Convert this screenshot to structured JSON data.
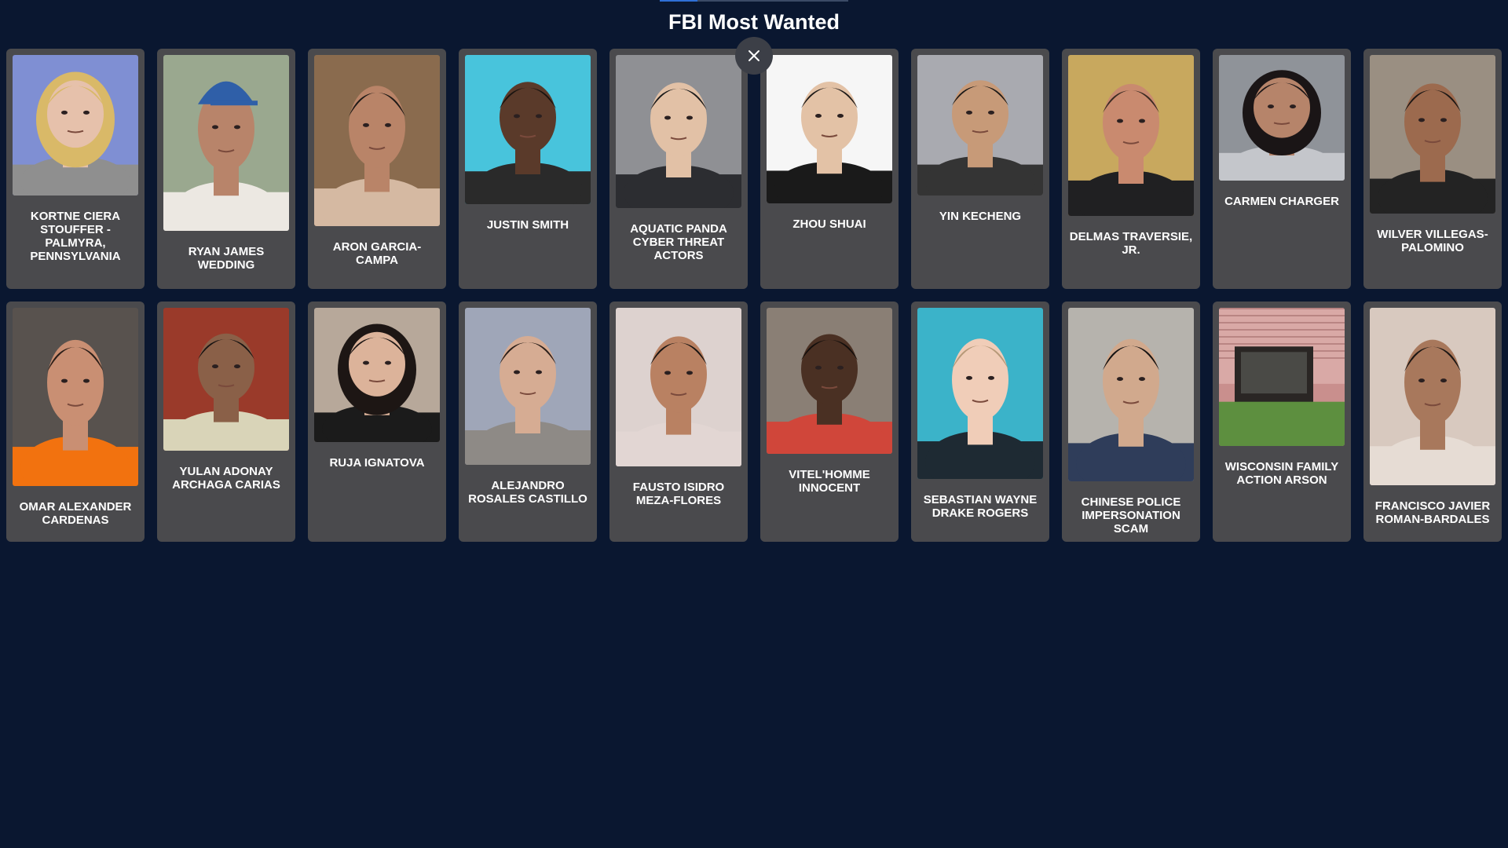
{
  "header": {
    "title": "FBI Most Wanted",
    "progress": 0.2
  },
  "close_icon": "close-icon",
  "wanted": [
    {
      "name": "KORTNE CIERA STOUFFER - PALMYRA, PENNSYLVANIA",
      "photo_ratio": 1.12,
      "bg": "#7f8fd3",
      "skin": "#e6c1ab",
      "hair": "#d9b968",
      "shirt": "#8f8f8f",
      "hair_style": "long"
    },
    {
      "name": "RYAN JAMES WEDDING",
      "photo_ratio": 1.4,
      "bg": "#9aa88f",
      "skin": "#b8846a",
      "hair": "#2f5fa8",
      "shirt": "#ece8e2",
      "hair_style": "cap"
    },
    {
      "name": "ARON GARCIA-CAMPA",
      "photo_ratio": 1.36,
      "bg": "#8a6b4e",
      "skin": "#b98468",
      "hair": "#1f1a17",
      "shirt": "#d5b9a2",
      "hair_style": "short"
    },
    {
      "name": "JUSTIN SMITH",
      "photo_ratio": 1.19,
      "bg": "#48c4dc",
      "skin": "#5a3a2a",
      "hair": "#1a1410",
      "shirt": "#2a2a2a",
      "hair_style": "short"
    },
    {
      "name": "AQUATIC PANDA CYBER THREAT ACTORS",
      "photo_ratio": 1.22,
      "bg": "#8f9094",
      "skin": "#e2c1a6",
      "hair": "#1b1b1b",
      "shirt": "#2c2d31",
      "hair_style": "short"
    },
    {
      "name": "ZHOU SHUAI",
      "photo_ratio": 1.18,
      "bg": "#f6f6f6",
      "skin": "#e3c2a6",
      "hair": "#1f1b19",
      "shirt": "#1a1a1a",
      "hair_style": "short"
    },
    {
      "name": "YIN KECHENG",
      "photo_ratio": 1.12,
      "bg": "#a9aab0",
      "skin": "#c79a78",
      "hair": "#1c1a19",
      "shirt": "#343434",
      "hair_style": "short"
    },
    {
      "name": "DELMAS TRAVERSIE, JR.",
      "photo_ratio": 1.28,
      "bg": "#c8a85e",
      "skin": "#c98a6f",
      "hair": "#3a2a22",
      "shirt": "#202022",
      "hair_style": "short"
    },
    {
      "name": "CARMEN CHARGER",
      "photo_ratio": 1.0,
      "bg": "#8f9399",
      "skin": "#b6846a",
      "hair": "#1a1516",
      "shirt": "#c4c6cb",
      "hair_style": "long"
    },
    {
      "name": "WILVER VILLEGAS-PALOMINO",
      "photo_ratio": 1.26,
      "bg": "#9a8f82",
      "skin": "#9c6a4e",
      "hair": "#1c1715",
      "shirt": "#232323",
      "hair_style": "short"
    },
    {
      "name": "OMAR ALEXANDER CARDENAS",
      "photo_ratio": 1.42,
      "bg": "#58524e",
      "skin": "#c98f73",
      "hair": "#2a1d17",
      "shirt": "#f2720f",
      "hair_style": "short"
    },
    {
      "name": "YULAN ADONAY ARCHAGA CARIAS",
      "photo_ratio": 1.14,
      "bg": "#9a3a2a",
      "skin": "#8a6048",
      "hair": "#171312",
      "shirt": "#d9d4b8",
      "hair_style": "short"
    },
    {
      "name": "RUJA IGNATOVA",
      "photo_ratio": 1.07,
      "bg": "#b7a89a",
      "skin": "#dcb39a",
      "hair": "#1d1614",
      "shirt": "#1b1b1b",
      "hair_style": "long"
    },
    {
      "name": "ALEJANDRO ROSALES CASTILLO",
      "photo_ratio": 1.25,
      "bg": "#9fa6b8",
      "skin": "#d6ac93",
      "hair": "#2b1f1a",
      "shirt": "#8e8a86",
      "hair_style": "short"
    },
    {
      "name": "FAUSTO ISIDRO MEZA-FLORES",
      "photo_ratio": 1.26,
      "bg": "#ddd2cf",
      "skin": "#b98162",
      "hair": "#191513",
      "shirt": "#e2d6d3",
      "hair_style": "short"
    },
    {
      "name": "VITEL'HOMME INNOCENT",
      "photo_ratio": 1.16,
      "bg": "#8a7f75",
      "skin": "#4a3023",
      "hair": "#140f0d",
      "shirt": "#d0463a",
      "hair_style": "short"
    },
    {
      "name": "SEBASTIAN WAYNE DRAKE ROGERS",
      "photo_ratio": 1.36,
      "bg": "#3bb3c9",
      "skin": "#f0cdb8",
      "hair": "#b79a79",
      "shirt": "#1e2a33",
      "hair_style": "short"
    },
    {
      "name": "CHINESE POLICE IMPERSONATION SCAM",
      "photo_ratio": 1.38,
      "bg": "#b6b3ad",
      "skin": "#d1a98d",
      "hair": "#161414",
      "shirt": "#2f3d5a",
      "hair_style": "short"
    },
    {
      "name": "WISCONSIN FAMILY ACTION ARSON",
      "photo_ratio": 1.1,
      "bg": "#c98f8d",
      "skin": "#c98f8d",
      "hair": "#c98f8d",
      "shirt": "#5d8f3f",
      "hair_style": "building"
    },
    {
      "name": "FRANCISCO JAVIER ROMAN-BARDALES",
      "photo_ratio": 1.41,
      "bg": "#d8c9bf",
      "skin": "#a8785c",
      "hair": "#1b1614",
      "shirt": "#e6dcd4",
      "hair_style": "short"
    }
  ]
}
